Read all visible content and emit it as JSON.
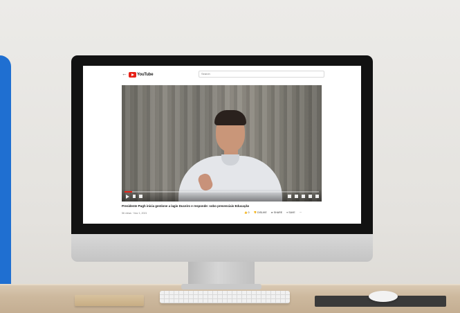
{
  "browser": {
    "logo_text": "YouTube",
    "search_placeholder": "Search"
  },
  "video": {
    "title": "Presidente Pugh inicia gestione a lagio Duceiro e responde: sobo presenciais Educação",
    "meta": "56 views · Nov 1, 2021",
    "progress": 0.04,
    "actions": [
      {
        "label": "0",
        "icon": "thumb-up-icon"
      },
      {
        "label": "DISLIKE",
        "icon": "thumb-down-icon"
      },
      {
        "label": "SHARE",
        "icon": "share-icon"
      },
      {
        "label": "SAVE",
        "icon": "save-icon"
      }
    ]
  },
  "colors": {
    "accent": "#1f6fd1",
    "youtube_red": "#e62117"
  }
}
